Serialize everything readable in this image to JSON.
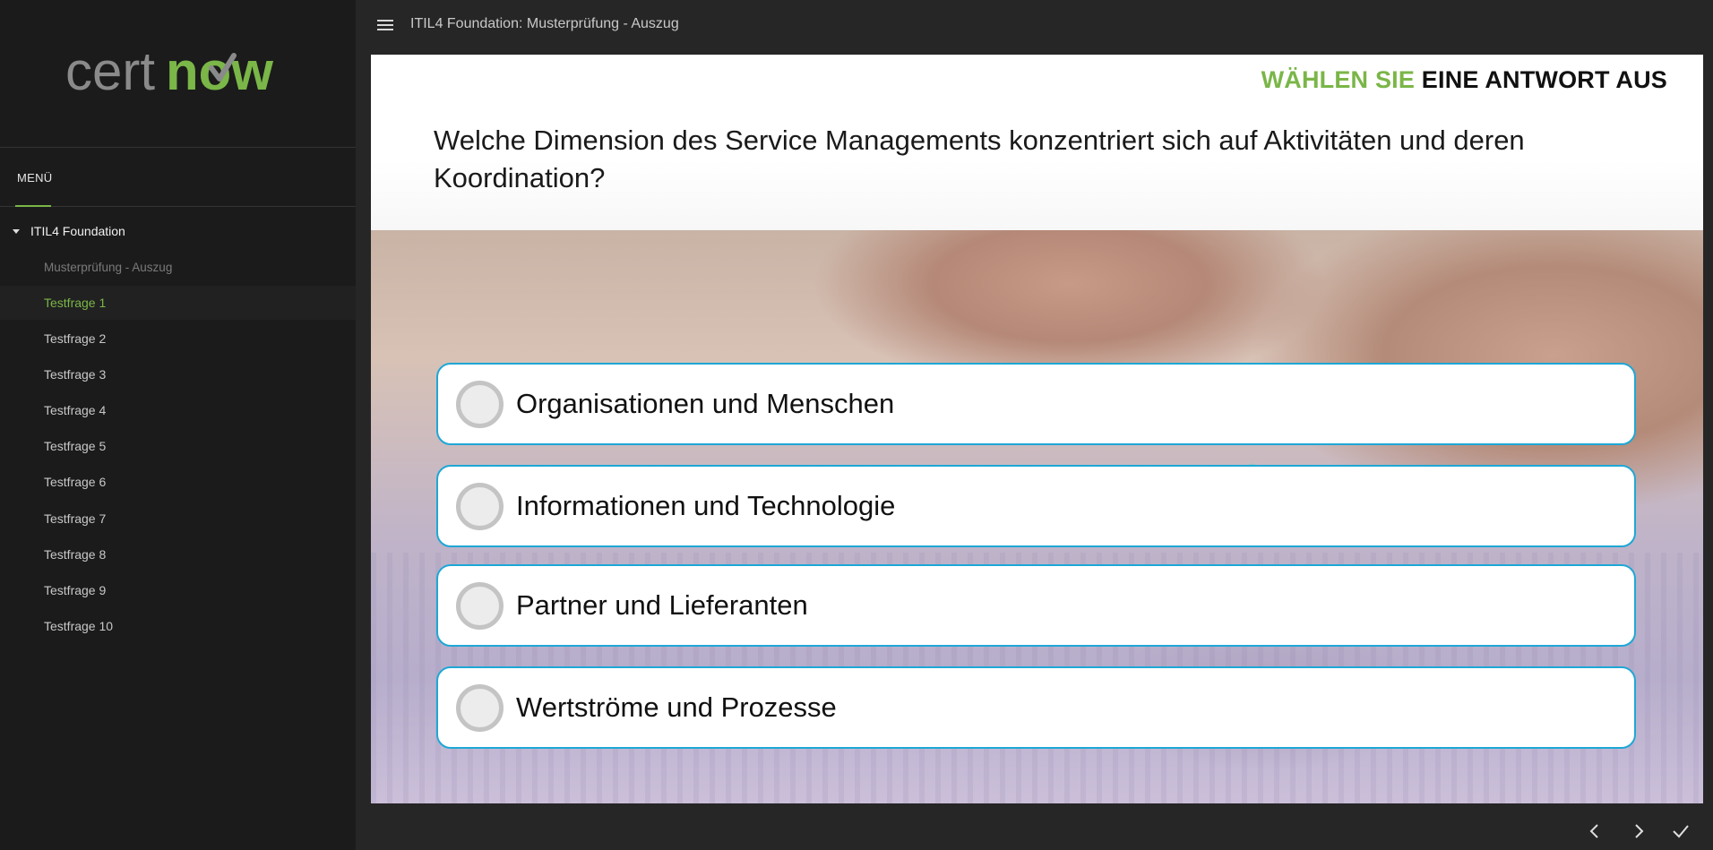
{
  "brand": {
    "logo_text_left": "cert",
    "logo_text_right": "now",
    "colors": {
      "accent_green": "#7ab648",
      "answer_border": "#1ea7d6",
      "logo_gray": "#8a8a8a"
    }
  },
  "topbar": {
    "menu_icon": "hamburger-icon",
    "title": "ITIL4 Foundation: Musterprüfung - Auszug"
  },
  "sidebar": {
    "tab_label": "MENÜ",
    "course_title": "ITIL4 Foundation",
    "section_title": "Musterprüfung - Auszug",
    "items": [
      {
        "label": "Testfrage 1",
        "active": true
      },
      {
        "label": "Testfrage 2",
        "active": false
      },
      {
        "label": "Testfrage 3",
        "active": false
      },
      {
        "label": "Testfrage 4",
        "active": false
      },
      {
        "label": "Testfrage 5",
        "active": false
      },
      {
        "label": "Testfrage 6",
        "active": false
      },
      {
        "label": "Testfrage 7",
        "active": false
      },
      {
        "label": "Testfrage 8",
        "active": false
      },
      {
        "label": "Testfrage 9",
        "active": false
      },
      {
        "label": "Testfrage 10",
        "active": false
      }
    ]
  },
  "slide": {
    "instruction_green": "WÄHLEN SIE",
    "instruction_black": "EINE ANTWORT AUS",
    "question": "Welche Dimension des Service Managements konzentriert sich auf Aktivitäten und deren Koordination?",
    "answers": [
      "Organisationen und Menschen",
      "Informationen und Technologie",
      "Partner und Lieferanten",
      "Wertströme und Prozesse"
    ]
  },
  "footer": {
    "prev_icon": "chevron-left-icon",
    "next_icon": "chevron-right-icon",
    "submit_icon": "checkmark-icon"
  }
}
